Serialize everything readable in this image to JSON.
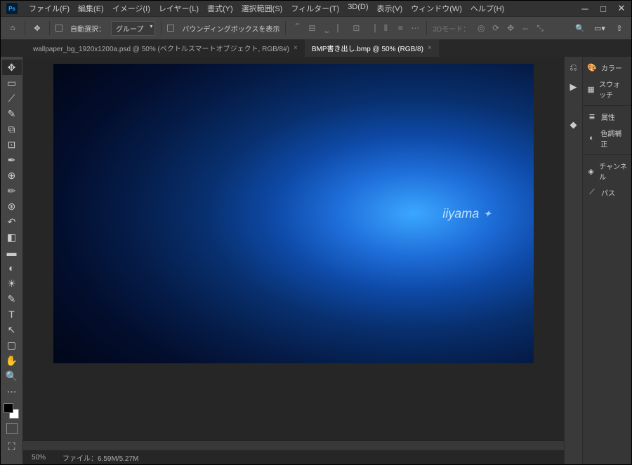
{
  "menubar": {
    "items": [
      "ファイル(F)",
      "編集(E)",
      "イメージ(I)",
      "レイヤー(L)",
      "書式(Y)",
      "選択範囲(S)",
      "フィルター(T)",
      "3D(D)",
      "表示(V)",
      "ウィンドウ(W)",
      "ヘルプ(H)"
    ]
  },
  "optionsbar": {
    "auto_select_label": "自動選択：",
    "group_dropdown": "グループ",
    "bounding_label": "バウンディングボックスを表示",
    "threed_mode": "3Dモード："
  },
  "tabs": [
    {
      "label": "wallpaper_bg_1920x1200a.psd @ 50% (ベクトルスマートオブジェクト, RGB/8#)",
      "active": false
    },
    {
      "label": "BMP書き出し.bmp @ 50% (RGB/8)",
      "active": true
    }
  ],
  "canvas": {
    "brand": "iiyama"
  },
  "statusbar": {
    "zoom": "50%",
    "file_info": "ファイル：6.59M/5.27M"
  },
  "panels": {
    "items": [
      "カラー",
      "スウォッチ",
      "属性",
      "色調補正",
      "チャンネル",
      "パス"
    ]
  }
}
